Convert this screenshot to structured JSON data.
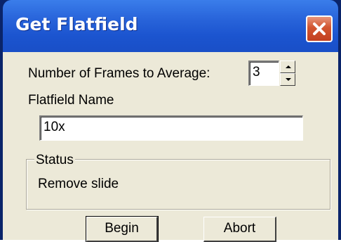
{
  "window": {
    "title": "Get Flatfield",
    "close_icon": "close-icon"
  },
  "form": {
    "frames_label": "Number of Frames to Average:",
    "frames_value": "3",
    "name_label": "Flatfield Name",
    "name_value": "10x"
  },
  "status": {
    "legend": "Status",
    "text": "Remove slide"
  },
  "buttons": {
    "begin": "Begin",
    "abort": "Abort"
  },
  "colors": {
    "titlebar": "#2762d9",
    "client": "#ece9d8",
    "close": "#d2552f"
  }
}
